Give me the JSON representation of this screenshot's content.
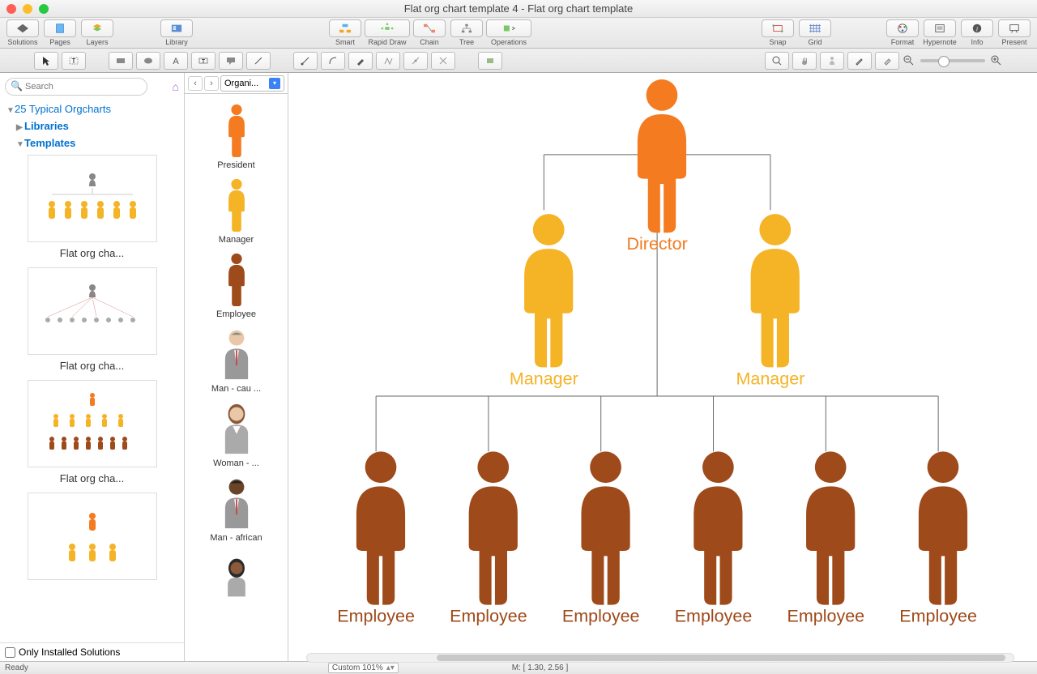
{
  "window": {
    "title": "Flat org chart template 4 - Flat org chart template"
  },
  "toolbar": {
    "solutions": "Solutions",
    "pages": "Pages",
    "layers": "Layers",
    "library": "Library",
    "smart": "Smart",
    "rapid": "Rapid Draw",
    "chain": "Chain",
    "tree": "Tree",
    "ops": "Operations",
    "snap": "Snap",
    "grid": "Grid",
    "format": "Format",
    "hypernote": "Hypernote",
    "info": "Info",
    "present": "Present"
  },
  "sidebar": {
    "search_ph": "Search",
    "root": "25 Typical Orgcharts",
    "libraries": "Libraries",
    "templates": "Templates",
    "tmpl": [
      "Flat org cha...",
      "Flat org cha...",
      "Flat org cha..."
    ],
    "only_installed": "Only Installed Solutions"
  },
  "lib": {
    "dropdown": "Organi...",
    "items": [
      "President",
      "Manager",
      "Employee",
      "Man - cau ...",
      "Woman -  ...",
      "Man - african"
    ]
  },
  "chart": {
    "director": "Director",
    "manager": "Manager",
    "employee": "Employee",
    "colors": {
      "director": "#f47b20",
      "manager": "#f5b326",
      "employee": "#9e4a1a"
    }
  },
  "status": {
    "ready": "Ready",
    "zoom": "Custom 101%",
    "coords": "M: [ 1.30, 2.56 ]"
  }
}
